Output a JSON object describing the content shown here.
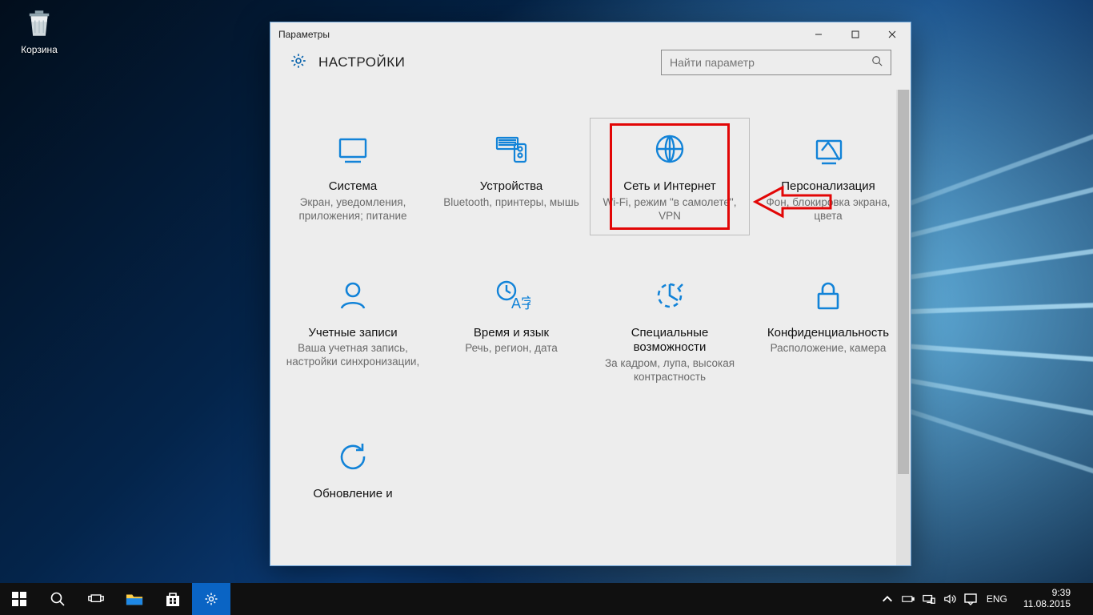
{
  "desktop": {
    "recycle_bin": "Корзина"
  },
  "window": {
    "title": "Параметры",
    "heading": "НАСТРОЙКИ",
    "search_placeholder": "Найти параметр"
  },
  "tiles": [
    {
      "name": "Система",
      "sub": "Экран, уведомления, приложения; питание"
    },
    {
      "name": "Устройства",
      "sub": "Bluetooth, принтеры, мышь"
    },
    {
      "name": "Сеть и Интернет",
      "sub": "Wi-Fi, режим \"в самолете\", VPN"
    },
    {
      "name": "Персонализация",
      "sub": "Фон, блокировка экрана, цвета"
    },
    {
      "name": "Учетные записи",
      "sub": "Ваша учетная запись, настройки синхронизации,"
    },
    {
      "name": "Время и язык",
      "sub": "Речь, регион, дата"
    },
    {
      "name": "Специальные возможности",
      "sub": "За кадром, лупа, высокая контрастность"
    },
    {
      "name": "Конфиденциальность",
      "sub": "Расположение, камера"
    },
    {
      "name": "Обновление и",
      "sub": ""
    }
  ],
  "taskbar": {
    "lang": "ENG",
    "time": "9:39",
    "date": "11.08.2015"
  }
}
